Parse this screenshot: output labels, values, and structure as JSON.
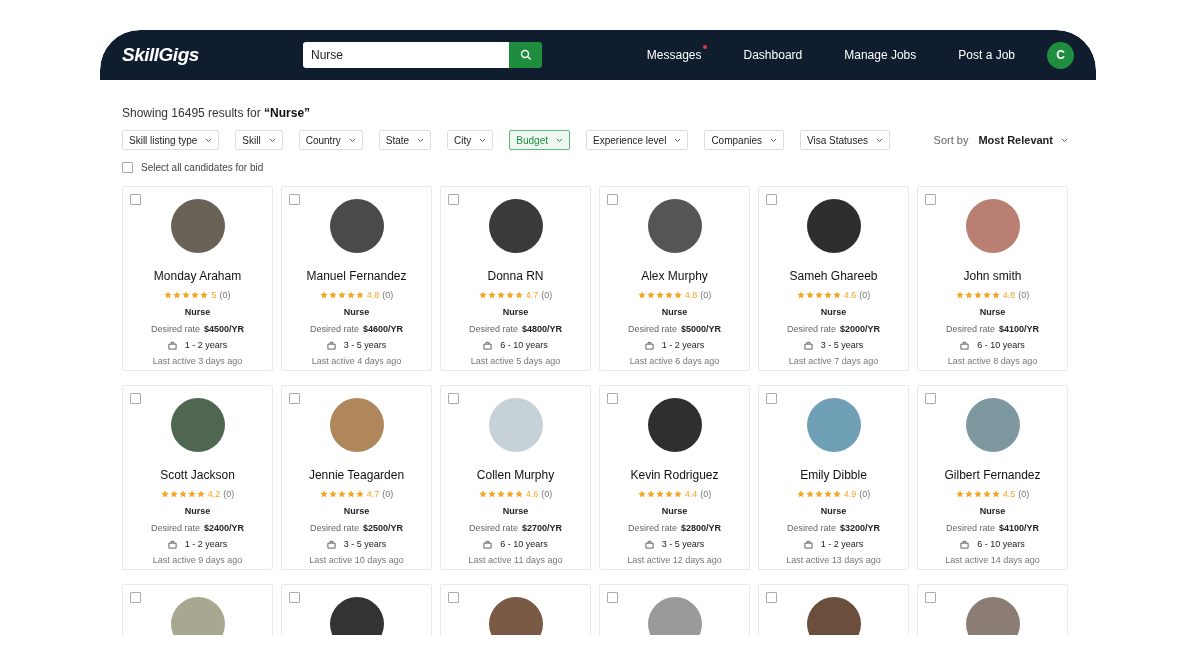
{
  "header": {
    "logo": "SkillGigs",
    "search": {
      "value": "Nurse"
    },
    "nav": [
      {
        "label": "Messages",
        "notification": true
      },
      {
        "label": "Dashboard",
        "notification": false
      },
      {
        "label": "Manage Jobs",
        "notification": false
      },
      {
        "label": "Post a Job",
        "notification": false
      }
    ],
    "avatar_initial": "C"
  },
  "results": {
    "prefix": "Showing 16495 results for ",
    "query": "“Nurse”"
  },
  "filters": [
    {
      "label": "Skill listing type",
      "active": false
    },
    {
      "label": "Skill",
      "active": false
    },
    {
      "label": "Country",
      "active": false
    },
    {
      "label": "State",
      "active": false
    },
    {
      "label": "City",
      "active": false
    },
    {
      "label": "Budget",
      "active": true
    },
    {
      "label": "Experience level",
      "active": false
    },
    {
      "label": "Companies",
      "active": false
    },
    {
      "label": "Visa Statuses",
      "active": false
    }
  ],
  "sort": {
    "label": "Sort by",
    "value": "Most Relevant"
  },
  "select_all": {
    "label": "Select all candidates for bid",
    "checked": false
  },
  "cards": [
    {
      "kind": "full",
      "name": "Monday Araham",
      "stars": 5,
      "rating": "5",
      "reviews": "(0)",
      "role": "Nurse",
      "rate_label": "Desired rate",
      "rate": "$4500/YR",
      "experience": "1 - 2 years",
      "last_active": "Last active 3 days ago",
      "checked": false
    },
    {
      "kind": "full",
      "name": "Manuel Fernandez",
      "stars": 5,
      "rating": "4.8",
      "reviews": "(0)",
      "role": "Nurse",
      "rate_label": "Desired rate",
      "rate": "$4600/YR",
      "experience": "3 - 5 years",
      "last_active": "Last active 4 days ago",
      "checked": false
    },
    {
      "kind": "full",
      "name": "Donna RN",
      "stars": 5,
      "rating": "4.7",
      "reviews": "(0)",
      "role": "Nurse",
      "rate_label": "Desired rate",
      "rate": "$4800/YR",
      "experience": "6 - 10 years",
      "last_active": "Last active 5 days ago",
      "checked": false
    },
    {
      "kind": "full",
      "name": "Alex Murphy",
      "stars": 5,
      "rating": "4.8",
      "reviews": "(0)",
      "role": "Nurse",
      "rate_label": "Desired rate",
      "rate": "$5000/YR",
      "experience": "1 - 2 years",
      "last_active": "Last active 6 days ago",
      "checked": false
    },
    {
      "kind": "full",
      "name": "Sameh Ghareeb",
      "stars": 5,
      "rating": "4.6",
      "reviews": "(0)",
      "role": "Nurse",
      "rate_label": "Desired rate",
      "rate": "$2000/YR",
      "experience": "3 - 5 years",
      "last_active": "Last active 7 days ago",
      "checked": false
    },
    {
      "kind": "full",
      "name": "John smith",
      "stars": 5,
      "rating": "4.8",
      "reviews": "(0)",
      "role": "Nurse",
      "rate_label": "Desired rate",
      "rate": "$4100/YR",
      "experience": "6 - 10 years",
      "last_active": "Last active 8 days ago",
      "checked": false
    },
    {
      "kind": "full",
      "name": "Scott Jackson",
      "stars": 5,
      "rating": "4.2",
      "reviews": "(0)",
      "role": "Nurse",
      "rate_label": "Desired rate",
      "rate": "$2400/YR",
      "experience": "1 - 2 years",
      "last_active": "Last active 9 days ago",
      "checked": false
    },
    {
      "kind": "full",
      "name": "Jennie Teagarden",
      "stars": 5,
      "rating": "4.7",
      "reviews": "(0)",
      "role": "Nurse",
      "rate_label": "Desired rate",
      "rate": "$2500/YR",
      "experience": "3 - 5 years",
      "last_active": "Last active 10 days ago",
      "checked": false
    },
    {
      "kind": "full",
      "name": "Collen Murphy",
      "stars": 5,
      "rating": "4.6",
      "reviews": "(0)",
      "role": "Nurse",
      "rate_label": "Desired rate",
      "rate": "$2700/YR",
      "experience": "6 - 10 years",
      "last_active": "Last active 11 days ago",
      "checked": false
    },
    {
      "kind": "full",
      "name": "Kevin Rodriguez",
      "stars": 5,
      "rating": "4.4",
      "reviews": "(0)",
      "role": "Nurse",
      "rate_label": "Desired rate",
      "rate": "$2800/YR",
      "experience": "3 - 5 years",
      "last_active": "Last active 12 days ago",
      "checked": false
    },
    {
      "kind": "full",
      "name": "Emily Dibble",
      "stars": 5,
      "rating": "4.9",
      "reviews": "(0)",
      "role": "Nurse",
      "rate_label": "Desired rate",
      "rate": "$3200/YR",
      "experience": "1 - 2 years",
      "last_active": "Last active 13 days ago",
      "checked": false
    },
    {
      "kind": "full",
      "name": "Gilbert Fernandez",
      "stars": 5,
      "rating": "4.5",
      "reviews": "(0)",
      "role": "Nurse",
      "rate_label": "Desired rate",
      "rate": "$4100/YR",
      "experience": "6 - 10 years",
      "last_active": "Last active 14 days ago",
      "checked": false
    },
    {
      "kind": "partial",
      "checked": false
    },
    {
      "kind": "partial",
      "checked": false
    },
    {
      "kind": "partial",
      "checked": false
    },
    {
      "kind": "partial",
      "checked": false
    },
    {
      "kind": "partial",
      "checked": false
    },
    {
      "kind": "partial",
      "checked": false
    }
  ]
}
